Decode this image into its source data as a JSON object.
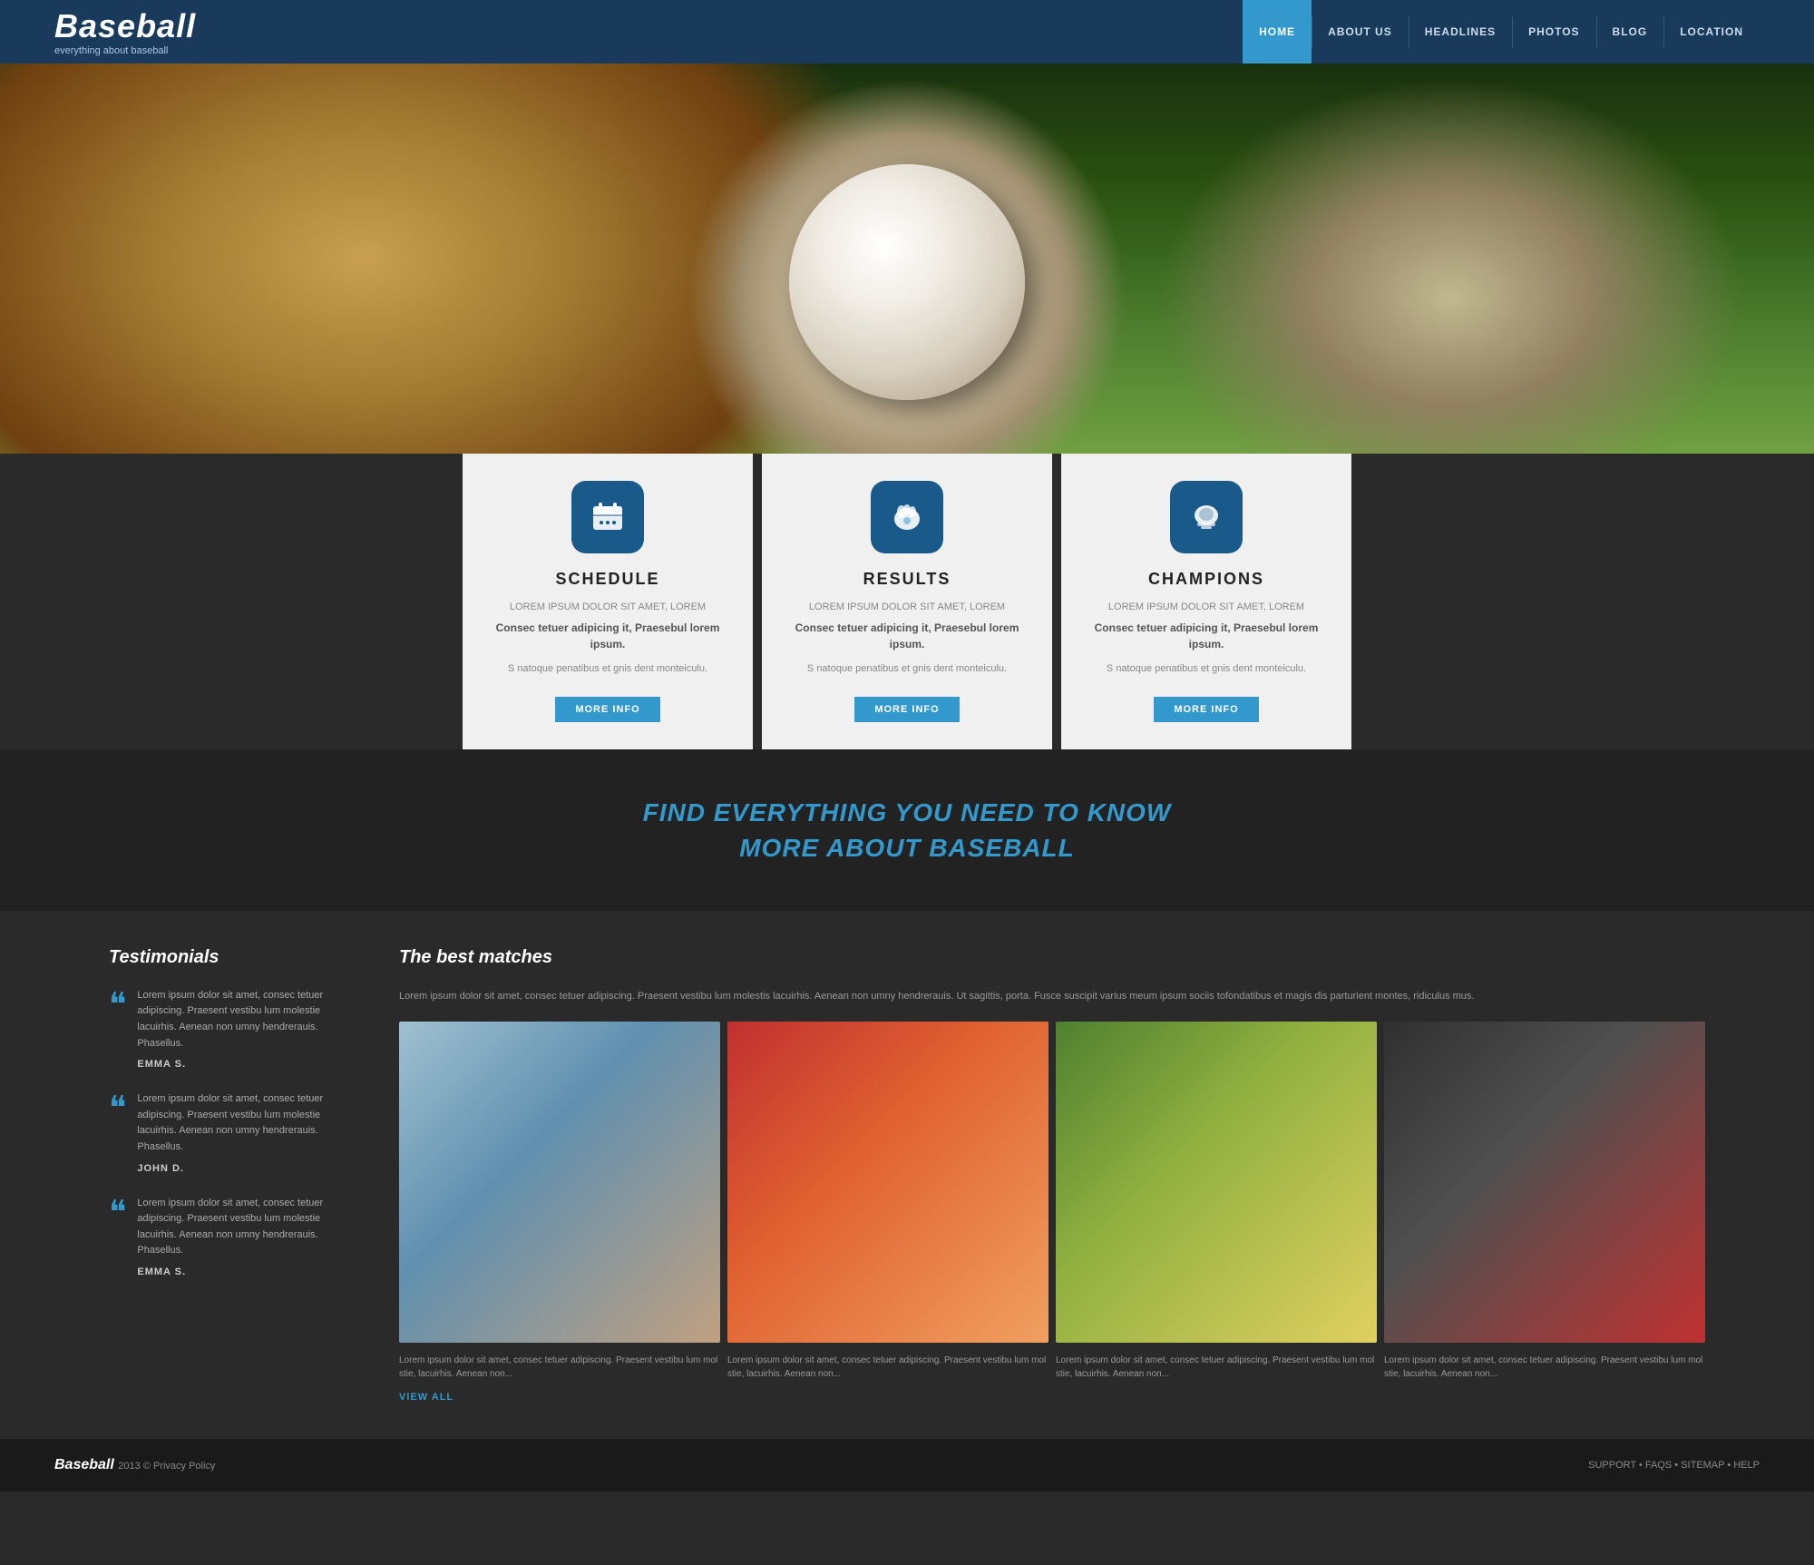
{
  "header": {
    "logo_title": "Baseball",
    "logo_sub": "everything about baseball",
    "nav": [
      {
        "label": "HOME",
        "active": true
      },
      {
        "label": "ABOUT US",
        "active": false
      },
      {
        "label": "HEADLINES",
        "active": false
      },
      {
        "label": "PHOTOS",
        "active": false
      },
      {
        "label": "BLOG",
        "active": false
      },
      {
        "label": "LOCATION",
        "active": false
      }
    ]
  },
  "cards": [
    {
      "icon": "⚾",
      "title": "SCHEDULE",
      "lorem": "LOREM IPSUM DOLOR SIT AMET, LOREM",
      "body": "Consec tetuer adipicing it, Praesebul lorem ipsum.",
      "light": "S natoque penatibus et gnis dent monteiculu.",
      "btn": "MORE INFO"
    },
    {
      "icon": "🧤",
      "title": "RESULTS",
      "lorem": "LOREM IPSUM DOLOR SIT AMET, LOREM",
      "body": "Consec tetuer adipicing it, Praesebul lorem ipsum.",
      "light": "S natoque penatibus et gnis dent monteiculu.",
      "btn": "MORE INFO"
    },
    {
      "icon": "🏆",
      "title": "CHAMPIONS",
      "lorem": "LOREM IPSUM DOLOR SIT AMET, LOREM",
      "body": "Consec tetuer adipicing it, Praesebul lorem ipsum.",
      "light": "S natoque penatibus et gnis dent monteiculu.",
      "btn": "MORE INFO"
    }
  ],
  "promo": {
    "line1": "FIND EVERYTHING YOU NEED TO KNOW",
    "line2": "MORE ABOUT BASEBALL"
  },
  "testimonials": {
    "title": "Testimonials",
    "items": [
      {
        "text": "Lorem ipsum dolor sit amet, consec tetuer adipiscing. Praesent vestibu lum molestie lacuirhis. Aenean non umny hendrerauis. Phasellus.",
        "author": "EMMA S."
      },
      {
        "text": "Lorem ipsum dolor sit amet, consec tetuer adipiscing. Praesent vestibu lum molestie lacuirhis. Aenean non umny hendrerauis. Phasellus.",
        "author": "JOHN D."
      },
      {
        "text": "Lorem ipsum dolor sit amet, consec tetuer adipiscing. Praesent vestibu lum molestie lacuirhis. Aenean non umny hendrerauis. Phasellus.",
        "author": "EMMA S."
      }
    ]
  },
  "best_matches": {
    "title": "The best matches",
    "intro": "Lorem ipsum dolor sit amet, consec tetuer adipiscing. Praesent vestibu lum molestis lacuirhis. Aenean non umny hendrerauis. Ut sagittis, porta. Fusce suscipit varius meum ipsum sociis tofondatibus et magis dis parturient montes, ridiculus mus.",
    "images": [
      {
        "alt": "player-girl",
        "caption": "Lorem ipsum dolor sit amet, consec tetuer adipiscing. Praesent vestibu lum mol stie, lacuirhis. Aenean non..."
      },
      {
        "alt": "batter-player",
        "caption": "Lorem ipsum dolor sit amet, consec tetuer adipiscing. Praesent vestibu lum mol stie, lacuirhis. Aenean non..."
      },
      {
        "alt": "baseball-glove",
        "caption": "Lorem ipsum dolor sit amet, consec tetuer adipiscing. Praesent vestibu lum mol stie, lacuirhis. Aenean non..."
      },
      {
        "alt": "player-26",
        "caption": "Lorem ipsum dolor sit amet, consec tetuer adipiscing. Praesent vestibu lum mol stie, lacuirhis. Aenean non..."
      }
    ],
    "view_all": "VIEW ALL"
  },
  "footer": {
    "logo": "Baseball",
    "copy": "2013 © Privacy Policy",
    "links": [
      "SUPPORT",
      "FAQS",
      "SITEMAP",
      "HELP"
    ]
  },
  "colors": {
    "accent": "#3399cc",
    "dark_bg": "#2a2a2a",
    "header_bg": "#1a3a5c",
    "card_bg": "#f0f0f0"
  }
}
